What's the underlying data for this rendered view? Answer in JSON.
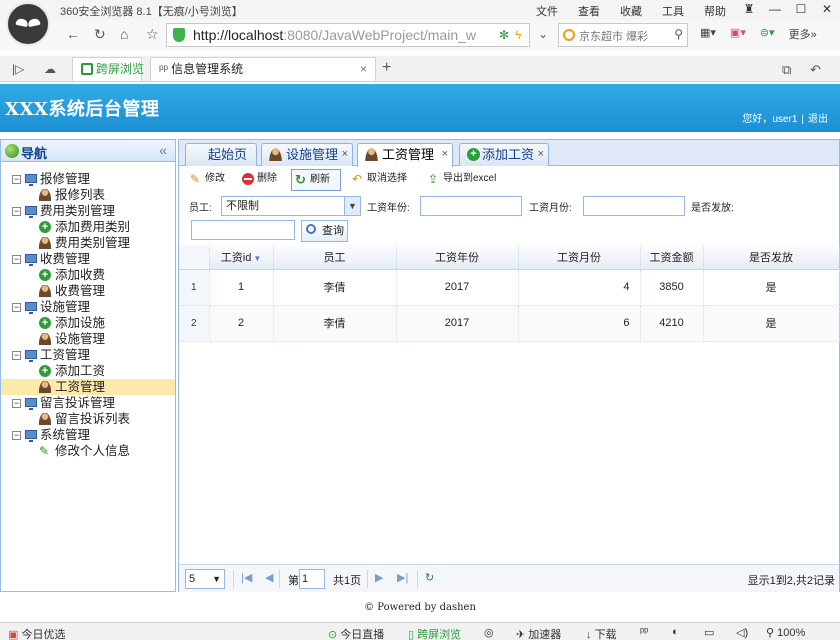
{
  "browser": {
    "title": "360安全浏览器 8.1【无痕/小号浏览】",
    "menu": [
      "文件",
      "查看",
      "收藏",
      "工具",
      "帮助"
    ],
    "address_host": "http://localhost",
    "address_path": ":8080/JavaWebProject/main_w",
    "search_text": "京东超市 爆彩",
    "right_tools": "更多»",
    "tabs": [
      {
        "label": "跨屏浏览"
      },
      {
        "label": "信息管理系统"
      }
    ]
  },
  "app": {
    "title": "XXX系统后台管理",
    "welcome": "您好，user1",
    "logout": "退出"
  },
  "sidebar": {
    "title": "导航",
    "groups": [
      {
        "label": "报修管理",
        "items": [
          "报修列表"
        ]
      },
      {
        "label": "费用类别管理",
        "items": [
          "添加费用类别",
          "费用类别管理"
        ]
      },
      {
        "label": "收费管理",
        "items": [
          "添加收费",
          "收费管理"
        ]
      },
      {
        "label": "设施管理",
        "items": [
          "添加设施",
          "设施管理"
        ]
      },
      {
        "label": "工资管理",
        "items": [
          "添加工资",
          "工资管理"
        ]
      },
      {
        "label": "留言投诉管理",
        "items": [
          "留言投诉列表"
        ]
      },
      {
        "label": "系统管理",
        "items": [
          "修改个人信息"
        ]
      }
    ]
  },
  "main": {
    "tabs": [
      {
        "label": "起始页"
      },
      {
        "label": "设施管理"
      },
      {
        "label": "工资管理"
      },
      {
        "label": "添加工资"
      }
    ],
    "toolbar": {
      "edit": "修改",
      "delete": "删除",
      "refresh": "刷新",
      "cancel": "取消选择",
      "export": "导出到excel"
    },
    "search": {
      "employee_label": "员工:",
      "employee_value": "不限制",
      "year_label": "工资年份:",
      "month_label": "工资月份:",
      "paid_label": "是否发放:",
      "query_label": "查询"
    },
    "grid": {
      "columns": [
        "工资id",
        "员工",
        "工资年份",
        "工资月份",
        "工资金额",
        "是否发放"
      ],
      "rows": [
        {
          "rn": "1",
          "id": "1",
          "employee": "李倩",
          "year": "2017",
          "month": "4",
          "amount": "3850",
          "paid": "是"
        },
        {
          "rn": "2",
          "id": "2",
          "employee": "李倩",
          "year": "2017",
          "month": "6",
          "amount": "4210",
          "paid": "是"
        }
      ]
    },
    "pager": {
      "page_size": "5",
      "page_prefix": "第",
      "page_value": "1",
      "total_pages": "共1页",
      "info": "显示1到2,共2记录"
    }
  },
  "footer": "© Powered by dashen",
  "statusbar": {
    "left": "今日优选",
    "live": "今日直播",
    "cross": "跨屏浏览",
    "accel": "加速器",
    "download": "下载",
    "zoom": "100%"
  }
}
